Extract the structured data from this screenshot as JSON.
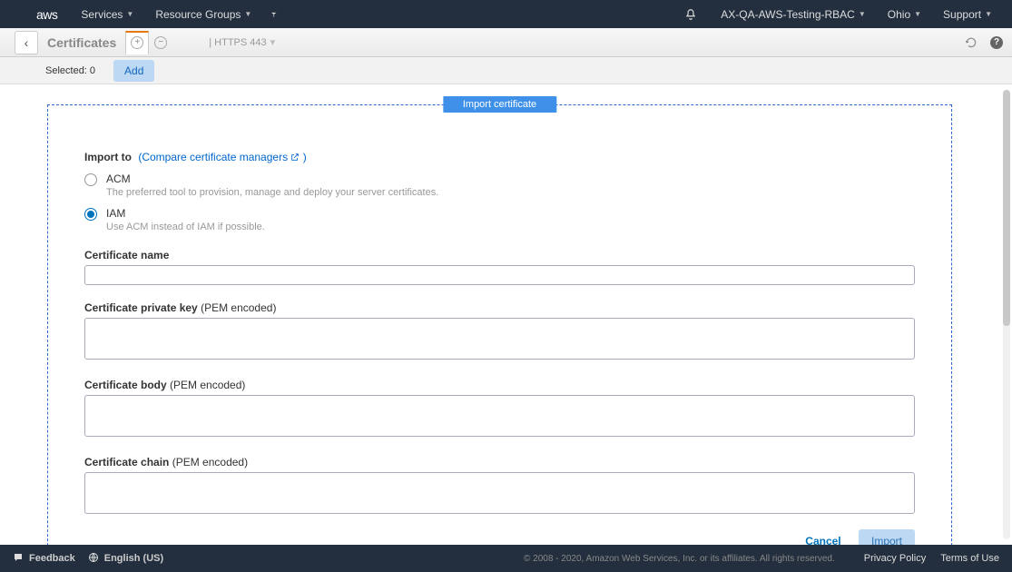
{
  "topnav": {
    "logo": "aws",
    "services": "Services",
    "resource_groups": "Resource Groups",
    "account": "AX-QA-AWS-Testing-RBAC",
    "region": "Ohio",
    "support": "Support"
  },
  "toolbar": {
    "title": "Certificates",
    "https_label": "| HTTPS 443"
  },
  "subbar": {
    "selected_label": "Selected: 0",
    "add_label": "Add"
  },
  "panel": {
    "title": "Import certificate",
    "import_to_label": "Import to",
    "compare_link": "(Compare certificate managers",
    "compare_link_suffix": ")",
    "radios": {
      "acm": {
        "label": "ACM",
        "desc": "The preferred tool to provision, manage and deploy your server certificates."
      },
      "iam": {
        "label": "IAM",
        "desc": "Use ACM instead of IAM if possible."
      }
    },
    "fields": {
      "cert_name": "Certificate name",
      "priv_key": "Certificate private key",
      "body": "Certificate body",
      "chain": "Certificate chain",
      "pem_suffix": "(PEM encoded)"
    },
    "actions": {
      "cancel": "Cancel",
      "import": "Import"
    }
  },
  "footer": {
    "feedback": "Feedback",
    "language": "English (US)",
    "copyright": "© 2008 - 2020, Amazon Web Services, Inc. or its affiliates. All rights reserved.",
    "privacy": "Privacy Policy",
    "terms": "Terms of Use"
  }
}
